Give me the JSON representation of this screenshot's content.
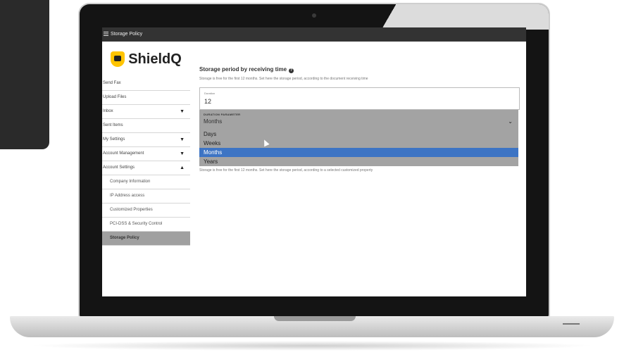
{
  "window": {
    "title": "Storage Policy"
  },
  "brand": {
    "name": "ShieldQ"
  },
  "sidebar": {
    "items": [
      {
        "label": "Send Fax"
      },
      {
        "label": "Upload Files"
      },
      {
        "label": "Inbox",
        "arrow": "▼"
      },
      {
        "label": "Sent Items"
      },
      {
        "label": "My Settings",
        "arrow": "▼"
      },
      {
        "label": "Account Management",
        "arrow": "▼"
      },
      {
        "label": "Account Settings",
        "arrow": "▲"
      }
    ],
    "subitems": [
      {
        "label": "Company Information"
      },
      {
        "label": "IP Address access"
      },
      {
        "label": "Customized Properties"
      },
      {
        "label": "PCI-DSS & Security Control"
      },
      {
        "label": "Storage Policy",
        "active": true
      }
    ]
  },
  "main": {
    "title": "Storage period by receiving time",
    "description": "Storage is free for the first 12 months. Set here the storage period, according to the document receiving time",
    "duration": {
      "label": "Duration",
      "value": "12"
    },
    "parameter": {
      "label": "DURATION PARAMETER",
      "value": "Months",
      "options": [
        "Days",
        "Weeks",
        "Months",
        "Years"
      ],
      "selected": "Months"
    },
    "description2": "Storage is free for the first 12 months. Set here the storage period, according to a selected customized property"
  },
  "colors": {
    "accent": "#3d74c4",
    "brand": "#ffc400",
    "titlebar": "#333333"
  }
}
